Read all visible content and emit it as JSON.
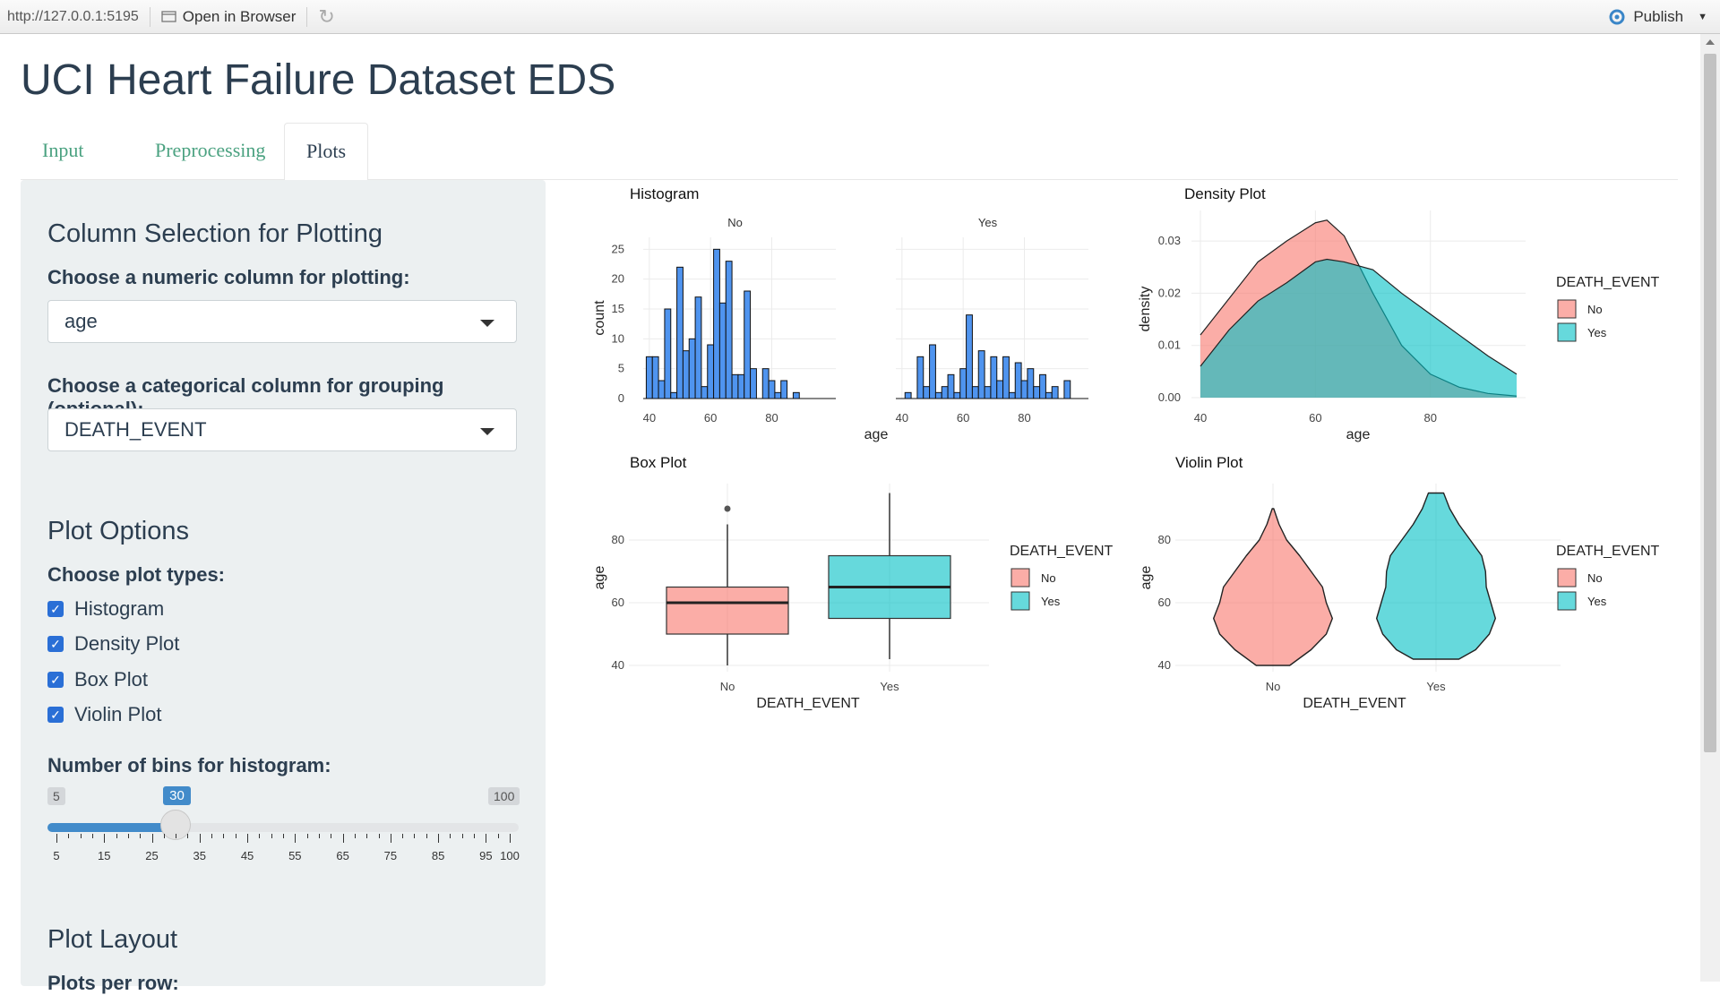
{
  "topbar": {
    "url": "http://127.0.0.1:5195",
    "open_in_browser": "Open in Browser",
    "publish": "Publish"
  },
  "page_title": "UCI Heart Failure Dataset EDS",
  "tabs": [
    {
      "label": "Input",
      "active": false
    },
    {
      "label": "Preprocessing",
      "active": false
    },
    {
      "label": "Plots",
      "active": true
    }
  ],
  "sidebar": {
    "section1_title": "Column Selection for Plotting",
    "numeric_label": "Choose a numeric column for plotting:",
    "numeric_value": "age",
    "categorical_label": "Choose a categorical column for grouping (optional):",
    "categorical_value": "DEATH_EVENT",
    "section2_title": "Plot Options",
    "plot_types_label": "Choose plot types:",
    "plot_types": [
      {
        "label": "Histogram",
        "checked": true
      },
      {
        "label": "Density Plot",
        "checked": true
      },
      {
        "label": "Box Plot",
        "checked": true
      },
      {
        "label": "Violin Plot",
        "checked": true
      }
    ],
    "bins_label": "Number of bins for histogram:",
    "bins": {
      "min": 5,
      "max": 100,
      "value": 30,
      "min_label": "5",
      "max_label": "100",
      "value_label": "30",
      "tick_labels": [
        "5",
        "15",
        "25",
        "35",
        "45",
        "55",
        "65",
        "75",
        "85",
        "95",
        "100"
      ]
    },
    "section3_title": "Plot Layout",
    "section3_next_label": "Plots per row:"
  },
  "colors": {
    "no": "#F8766D",
    "yes": "#00BFC4",
    "hist": "#4f94ef",
    "accent": "#428bca",
    "tab_link": "#4ba281"
  },
  "chart_data": [
    {
      "type": "bar",
      "title": "Histogram",
      "xlabel": "age",
      "ylabel": "count",
      "facets": [
        "No",
        "Yes"
      ],
      "xlim": [
        38,
        98
      ],
      "ylim": [
        0,
        27
      ],
      "xticks": [
        40,
        60,
        80
      ],
      "yticks": [
        0,
        5,
        10,
        15,
        20,
        25
      ],
      "bin_width": 2,
      "series": [
        {
          "name": "No",
          "x": [
            40,
            42,
            44,
            46,
            48,
            50,
            52,
            54,
            56,
            58,
            60,
            62,
            64,
            66,
            68,
            70,
            72,
            74,
            76,
            78,
            80,
            82,
            84,
            86,
            88,
            90
          ],
          "values": [
            7,
            7,
            3,
            15,
            1,
            22,
            8,
            10,
            17,
            2,
            9,
            25,
            16,
            23,
            4,
            4,
            18,
            5,
            0,
            5,
            3,
            1,
            3,
            0,
            1,
            0
          ]
        },
        {
          "name": "Yes",
          "x": [
            40,
            42,
            44,
            46,
            48,
            50,
            52,
            54,
            56,
            58,
            60,
            62,
            64,
            66,
            68,
            70,
            72,
            74,
            76,
            78,
            80,
            82,
            84,
            86,
            88,
            90,
            92,
            94
          ],
          "values": [
            0,
            1,
            0,
            7,
            2,
            9,
            1,
            2,
            4,
            1,
            5,
            14,
            2,
            8,
            2,
            7,
            3,
            7,
            1,
            6,
            3,
            5,
            2,
            4,
            1,
            2,
            0,
            3
          ]
        }
      ]
    },
    {
      "type": "area",
      "title": "Density Plot",
      "xlabel": "age",
      "ylabel": "density",
      "xlim": [
        40,
        95
      ],
      "ylim": [
        0,
        0.035
      ],
      "xticks": [
        40,
        60,
        80
      ],
      "yticks": [
        "0.00",
        "0.01",
        "0.02",
        "0.03"
      ],
      "legend_title": "DEATH_EVENT",
      "series": [
        {
          "name": "No",
          "x": [
            40,
            45,
            50,
            55,
            60,
            62,
            65,
            70,
            75,
            80,
            85,
            90,
            95
          ],
          "values": [
            0.012,
            0.019,
            0.026,
            0.03,
            0.0335,
            0.034,
            0.031,
            0.02,
            0.01,
            0.0045,
            0.002,
            0.0008,
            0.0003
          ]
        },
        {
          "name": "Yes",
          "x": [
            40,
            45,
            50,
            55,
            60,
            62,
            65,
            70,
            75,
            80,
            85,
            90,
            95
          ],
          "values": [
            0.006,
            0.013,
            0.0185,
            0.022,
            0.026,
            0.0265,
            0.026,
            0.0245,
            0.02,
            0.016,
            0.012,
            0.008,
            0.0045
          ]
        }
      ]
    },
    {
      "type": "box",
      "title": "Box Plot",
      "xlabel": "DEATH_EVENT",
      "ylabel": "age",
      "ylim": [
        38,
        98
      ],
      "yticks": [
        40,
        60,
        80
      ],
      "categories": [
        "No",
        "Yes"
      ],
      "legend_title": "DEATH_EVENT",
      "series": [
        {
          "name": "No",
          "min": 40,
          "q1": 50,
          "median": 60,
          "q3": 65,
          "max": 85,
          "outliers": [
            90
          ]
        },
        {
          "name": "Yes",
          "min": 42,
          "q1": 55,
          "median": 65,
          "q3": 75,
          "max": 95,
          "outliers": []
        }
      ]
    },
    {
      "type": "violin",
      "title": "Violin Plot",
      "xlabel": "DEATH_EVENT",
      "ylabel": "age",
      "ylim": [
        38,
        98
      ],
      "yticks": [
        40,
        60,
        80
      ],
      "categories": [
        "No",
        "Yes"
      ],
      "legend_title": "DEATH_EVENT",
      "series": [
        {
          "name": "No",
          "y": [
            40,
            45,
            50,
            55,
            60,
            65,
            70,
            75,
            80,
            85,
            90
          ],
          "halfwidth": [
            0.22,
            0.5,
            0.7,
            0.78,
            0.7,
            0.65,
            0.5,
            0.35,
            0.18,
            0.08,
            0.01
          ]
        },
        {
          "name": "Yes",
          "y": [
            42,
            45,
            50,
            55,
            60,
            65,
            70,
            75,
            80,
            85,
            90,
            95
          ],
          "halfwidth": [
            0.3,
            0.52,
            0.7,
            0.78,
            0.72,
            0.66,
            0.65,
            0.6,
            0.45,
            0.3,
            0.18,
            0.1
          ]
        }
      ]
    }
  ]
}
